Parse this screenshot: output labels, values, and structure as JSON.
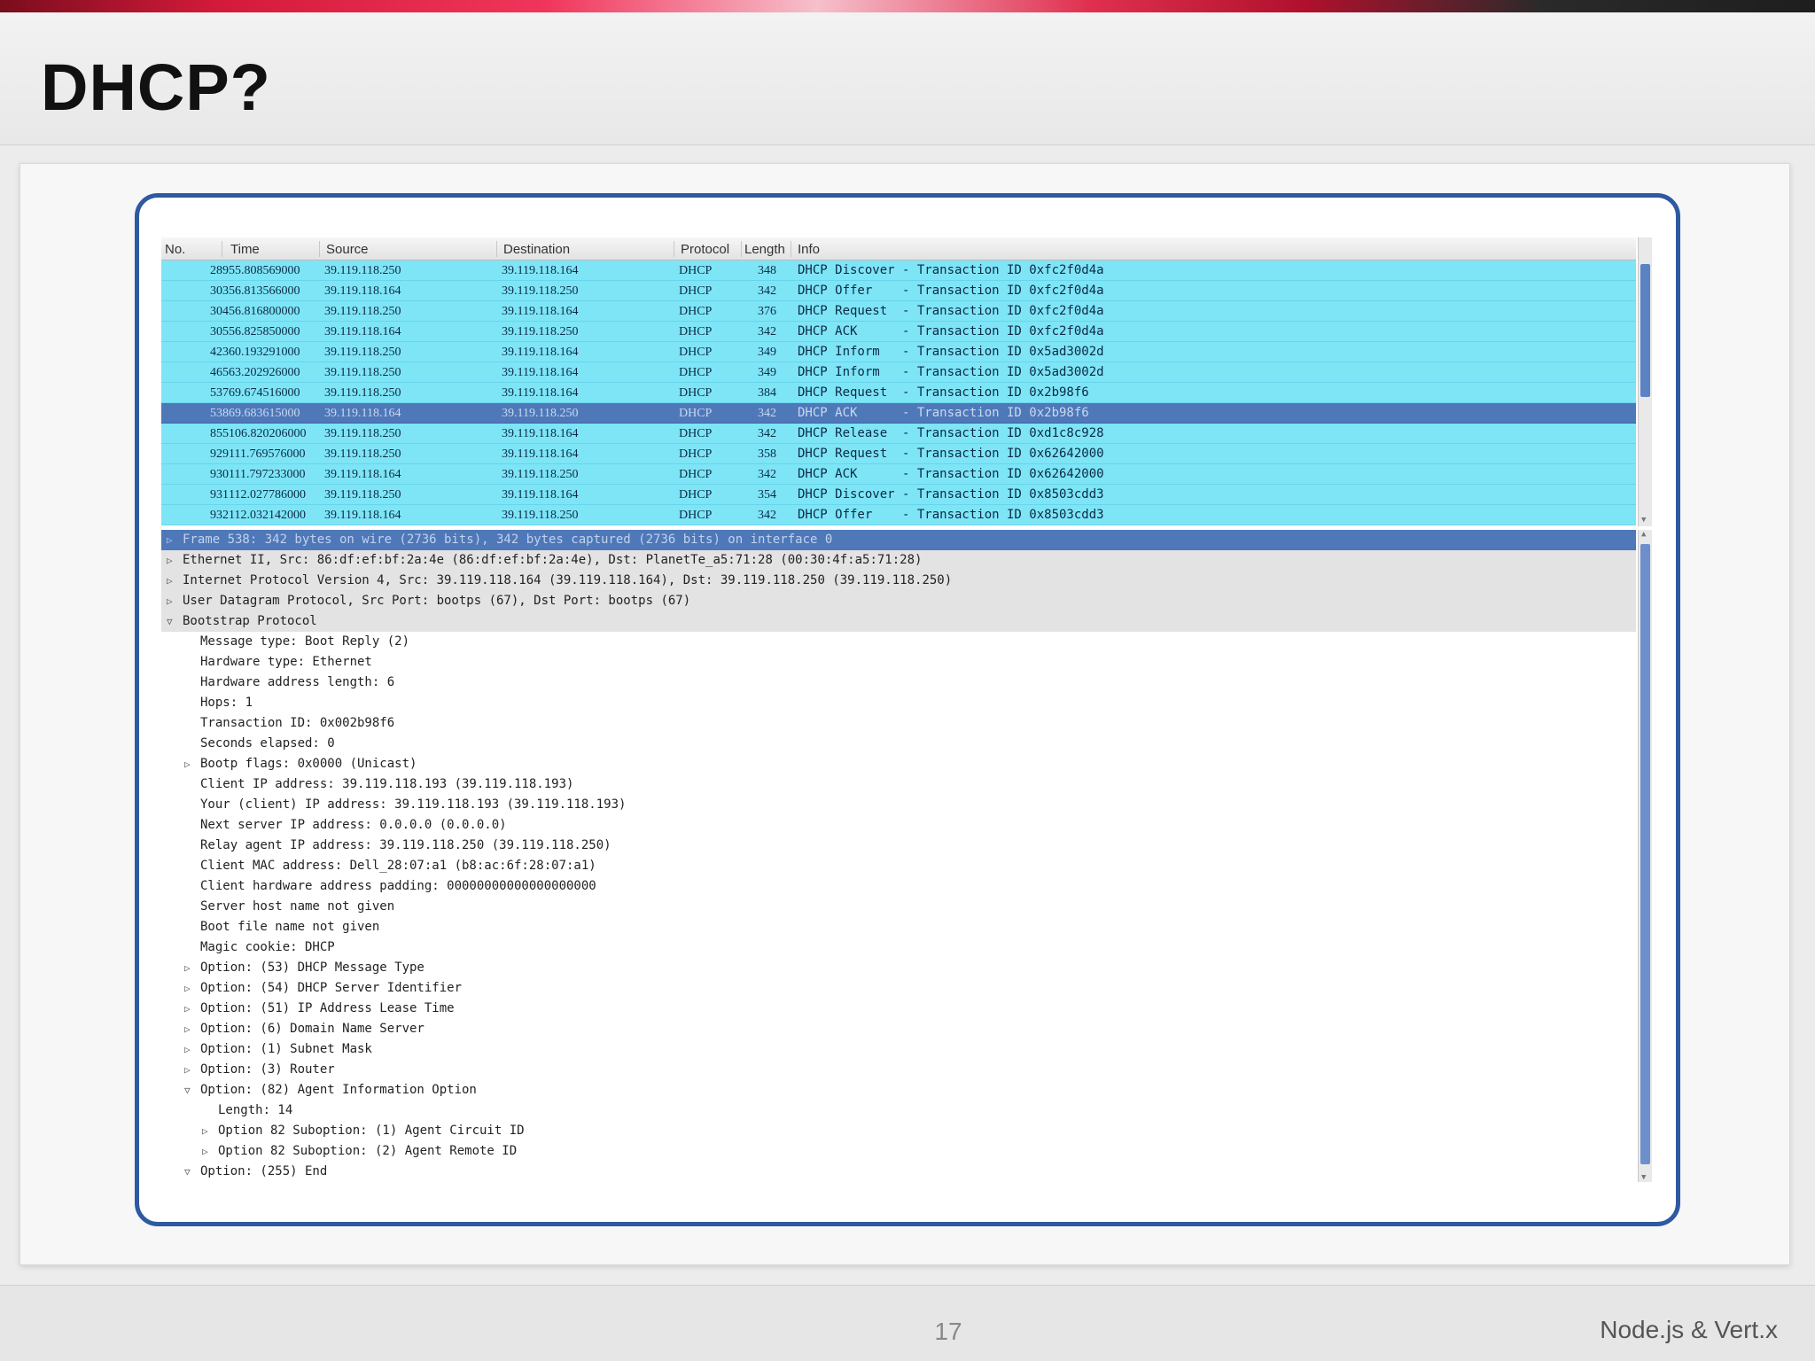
{
  "slide": {
    "title": "DHCP?",
    "page_number": "17",
    "footer_label": "Node.js & Vert.x",
    "accent_color": "#2d5aa0"
  },
  "packet_list": {
    "columns": [
      "No.",
      "Time",
      "Source",
      "Destination",
      "Protocol",
      "Length",
      "Info"
    ],
    "rows": [
      {
        "no": "289",
        "time": "55.808569000",
        "src": "39.119.118.250",
        "dst": "39.119.118.164",
        "proto": "DHCP",
        "len": "348",
        "info": "DHCP Discover - Transaction ID 0xfc2f0d4a"
      },
      {
        "no": "303",
        "time": "56.813566000",
        "src": "39.119.118.164",
        "dst": "39.119.118.250",
        "proto": "DHCP",
        "len": "342",
        "info": "DHCP Offer    - Transaction ID 0xfc2f0d4a"
      },
      {
        "no": "304",
        "time": "56.816800000",
        "src": "39.119.118.250",
        "dst": "39.119.118.164",
        "proto": "DHCP",
        "len": "376",
        "info": "DHCP Request  - Transaction ID 0xfc2f0d4a"
      },
      {
        "no": "305",
        "time": "56.825850000",
        "src": "39.119.118.164",
        "dst": "39.119.118.250",
        "proto": "DHCP",
        "len": "342",
        "info": "DHCP ACK      - Transaction ID 0xfc2f0d4a"
      },
      {
        "no": "423",
        "time": "60.193291000",
        "src": "39.119.118.250",
        "dst": "39.119.118.164",
        "proto": "DHCP",
        "len": "349",
        "info": "DHCP Inform   - Transaction ID 0x5ad3002d"
      },
      {
        "no": "465",
        "time": "63.202926000",
        "src": "39.119.118.250",
        "dst": "39.119.118.164",
        "proto": "DHCP",
        "len": "349",
        "info": "DHCP Inform   - Transaction ID 0x5ad3002d"
      },
      {
        "no": "537",
        "time": "69.674516000",
        "src": "39.119.118.250",
        "dst": "39.119.118.164",
        "proto": "DHCP",
        "len": "384",
        "info": "DHCP Request  - Transaction ID 0x2b98f6"
      },
      {
        "no": "538",
        "time": "69.683615000",
        "src": "39.119.118.164",
        "dst": "39.119.118.250",
        "proto": "DHCP",
        "len": "342",
        "info": "DHCP ACK      - Transaction ID 0x2b98f6",
        "selected": true
      },
      {
        "no": "855",
        "time": "106.820206000",
        "src": "39.119.118.250",
        "dst": "39.119.118.164",
        "proto": "DHCP",
        "len": "342",
        "info": "DHCP Release  - Transaction ID 0xd1c8c928"
      },
      {
        "no": "929",
        "time": "111.769576000",
        "src": "39.119.118.250",
        "dst": "39.119.118.164",
        "proto": "DHCP",
        "len": "358",
        "info": "DHCP Request  - Transaction ID 0x62642000"
      },
      {
        "no": "930",
        "time": "111.797233000",
        "src": "39.119.118.164",
        "dst": "39.119.118.250",
        "proto": "DHCP",
        "len": "342",
        "info": "DHCP ACK      - Transaction ID 0x62642000"
      },
      {
        "no": "931",
        "time": "112.027786000",
        "src": "39.119.118.250",
        "dst": "39.119.118.164",
        "proto": "DHCP",
        "len": "354",
        "info": "DHCP Discover - Transaction ID 0x8503cdd3"
      },
      {
        "no": "932",
        "time": "112.032142000",
        "src": "39.119.118.164",
        "dst": "39.119.118.250",
        "proto": "DHCP",
        "len": "342",
        "info": "DHCP Offer    - Transaction ID 0x8503cdd3"
      }
    ]
  },
  "detail_tree": [
    {
      "text": "Frame 538: 342 bytes on wire (2736 bits), 342 bytes captured (2736 bits) on interface 0",
      "indent": 0,
      "toggle": "collapsed",
      "style": "selhead"
    },
    {
      "text": "Ethernet II, Src: 86:df:ef:bf:2a:4e (86:df:ef:bf:2a:4e), Dst: PlanetTe_a5:71:28 (00:30:4f:a5:71:28)",
      "indent": 0,
      "toggle": "collapsed",
      "style": "shade"
    },
    {
      "text": "Internet Protocol Version 4, Src: 39.119.118.164 (39.119.118.164), Dst: 39.119.118.250 (39.119.118.250)",
      "indent": 0,
      "toggle": "collapsed",
      "style": "shade"
    },
    {
      "text": "User Datagram Protocol, Src Port: bootps (67), Dst Port: bootps (67)",
      "indent": 0,
      "toggle": "collapsed",
      "style": "shade"
    },
    {
      "text": "Bootstrap Protocol",
      "indent": 0,
      "toggle": "expanded",
      "style": "shade"
    },
    {
      "text": "Message type: Boot Reply (2)",
      "indent": 1,
      "toggle": "none",
      "style": ""
    },
    {
      "text": "Hardware type: Ethernet",
      "indent": 1,
      "toggle": "none",
      "style": ""
    },
    {
      "text": "Hardware address length: 6",
      "indent": 1,
      "toggle": "none",
      "style": ""
    },
    {
      "text": "Hops: 1",
      "indent": 1,
      "toggle": "none",
      "style": ""
    },
    {
      "text": "Transaction ID: 0x002b98f6",
      "indent": 1,
      "toggle": "none",
      "style": ""
    },
    {
      "text": "Seconds elapsed: 0",
      "indent": 1,
      "toggle": "none",
      "style": ""
    },
    {
      "text": "Bootp flags: 0x0000 (Unicast)",
      "indent": 1,
      "toggle": "collapsed",
      "style": ""
    },
    {
      "text": "Client IP address: 39.119.118.193 (39.119.118.193)",
      "indent": 1,
      "toggle": "none",
      "style": ""
    },
    {
      "text": "Your (client) IP address: 39.119.118.193 (39.119.118.193)",
      "indent": 1,
      "toggle": "none",
      "style": ""
    },
    {
      "text": "Next server IP address: 0.0.0.0 (0.0.0.0)",
      "indent": 1,
      "toggle": "none",
      "style": ""
    },
    {
      "text": "Relay agent IP address: 39.119.118.250 (39.119.118.250)",
      "indent": 1,
      "toggle": "none",
      "style": ""
    },
    {
      "text": "Client MAC address: Dell_28:07:a1 (b8:ac:6f:28:07:a1)",
      "indent": 1,
      "toggle": "none",
      "style": ""
    },
    {
      "text": "Client hardware address padding: 00000000000000000000",
      "indent": 1,
      "toggle": "none",
      "style": ""
    },
    {
      "text": "Server host name not given",
      "indent": 1,
      "toggle": "none",
      "style": ""
    },
    {
      "text": "Boot file name not given",
      "indent": 1,
      "toggle": "none",
      "style": ""
    },
    {
      "text": "Magic cookie: DHCP",
      "indent": 1,
      "toggle": "none",
      "style": ""
    },
    {
      "text": "Option: (53) DHCP Message Type",
      "indent": 1,
      "toggle": "collapsed",
      "style": ""
    },
    {
      "text": "Option: (54) DHCP Server Identifier",
      "indent": 1,
      "toggle": "collapsed",
      "style": ""
    },
    {
      "text": "Option: (51) IP Address Lease Time",
      "indent": 1,
      "toggle": "collapsed",
      "style": ""
    },
    {
      "text": "Option: (6) Domain Name Server",
      "indent": 1,
      "toggle": "collapsed",
      "style": ""
    },
    {
      "text": "Option: (1) Subnet Mask",
      "indent": 1,
      "toggle": "collapsed",
      "style": ""
    },
    {
      "text": "Option: (3) Router",
      "indent": 1,
      "toggle": "collapsed",
      "style": ""
    },
    {
      "text": "Option: (82) Agent Information Option",
      "indent": 1,
      "toggle": "expanded",
      "style": ""
    },
    {
      "text": "Length: 14",
      "indent": 2,
      "toggle": "none",
      "style": ""
    },
    {
      "text": "Option 82 Suboption: (1) Agent Circuit ID",
      "indent": 2,
      "toggle": "collapsed",
      "style": ""
    },
    {
      "text": "Option 82 Suboption: (2) Agent Remote ID",
      "indent": 2,
      "toggle": "collapsed",
      "style": ""
    },
    {
      "text": "Option: (255) End",
      "indent": 1,
      "toggle": "expanded",
      "style": ""
    }
  ],
  "icons": {
    "collapsed": "▷",
    "expanded": "▽",
    "scroll_up": "▲",
    "scroll_down": "▼"
  }
}
